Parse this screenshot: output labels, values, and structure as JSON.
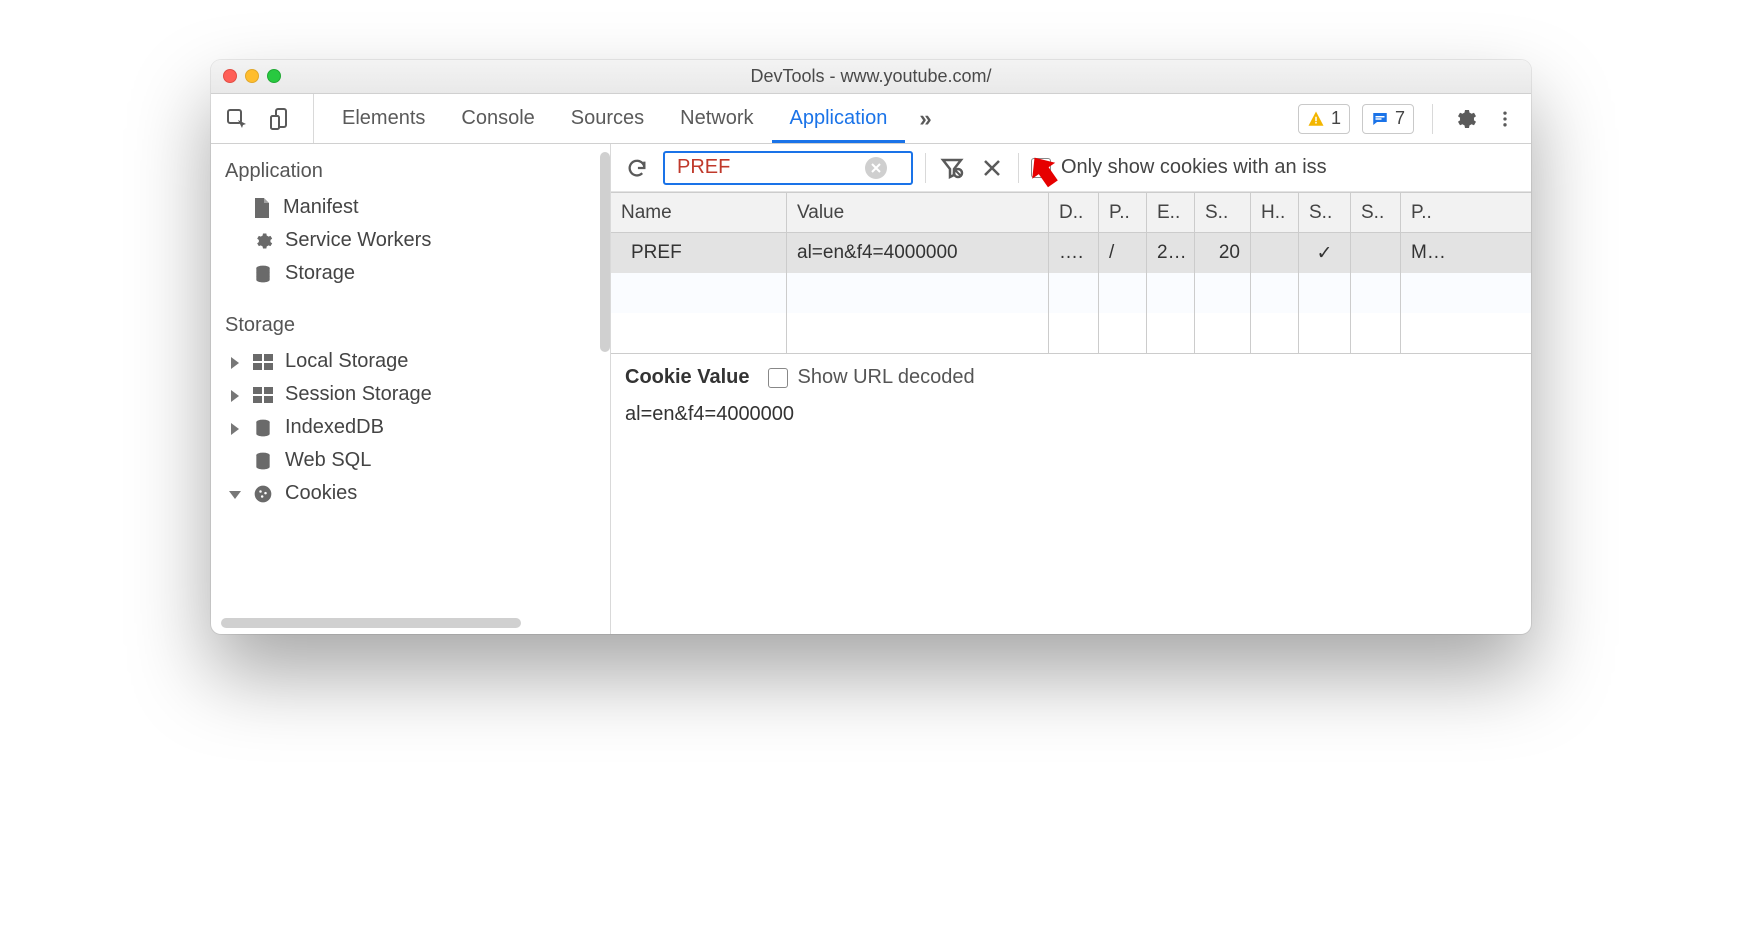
{
  "window": {
    "title": "DevTools - www.youtube.com/"
  },
  "toolbar": {
    "tabs": [
      "Elements",
      "Console",
      "Sources",
      "Network",
      "Application"
    ],
    "active_tab": "Application",
    "more": "»",
    "warnings_count": "1",
    "messages_count": "7"
  },
  "sidebar": {
    "section1_title": "Application",
    "app_items": [
      {
        "icon": "file-icon",
        "label": "Manifest"
      },
      {
        "icon": "gear-icon",
        "label": "Service Workers"
      },
      {
        "icon": "db-icon",
        "label": "Storage"
      }
    ],
    "section2_title": "Storage",
    "storage_items": [
      {
        "tri": "right",
        "icon": "grid-icon",
        "label": "Local Storage"
      },
      {
        "tri": "right",
        "icon": "grid-icon",
        "label": "Session Storage"
      },
      {
        "tri": "right",
        "icon": "db-icon",
        "label": "IndexedDB"
      },
      {
        "tri": "",
        "icon": "db-icon",
        "label": "Web SQL"
      },
      {
        "tri": "down",
        "icon": "cookie-icon",
        "label": "Cookies"
      }
    ]
  },
  "controls": {
    "filter_value": "PREF",
    "only_issue_label": "Only show cookies with an iss"
  },
  "table": {
    "headers": [
      "Name",
      "Value",
      "D..",
      "P..",
      "E..",
      "S..",
      "H..",
      "S..",
      "S..",
      "P.."
    ],
    "row": {
      "name": "PREF",
      "value": "al=en&f4=4000000",
      "d": "….",
      "p": "/",
      "e": "2…",
      "s": "20",
      "h": "",
      "s2": "✓",
      "s3": "",
      "pr": "M…"
    }
  },
  "cookie_pane": {
    "title": "Cookie Value",
    "decode_label": "Show URL decoded",
    "value": "al=en&f4=4000000"
  }
}
